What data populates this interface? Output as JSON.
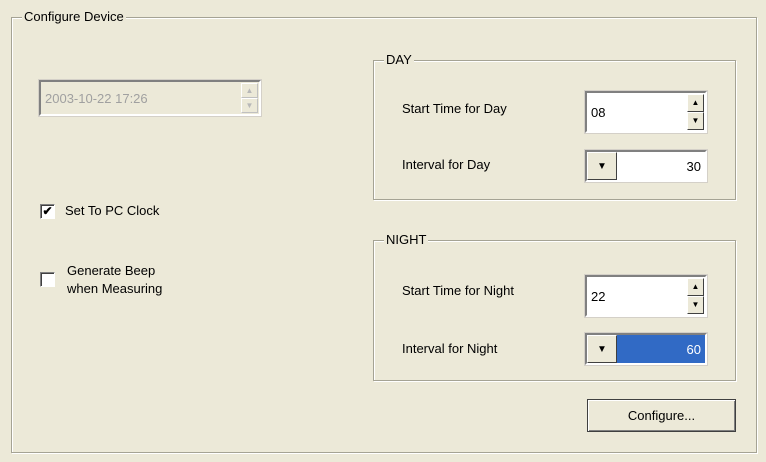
{
  "configure_group": {
    "title": "Configure Device"
  },
  "datetime": {
    "value": "2003-10-22 17:26",
    "up_icon": "▲",
    "down_icon": "▼"
  },
  "set_pc_clock": {
    "label": "Set To PC Clock",
    "checked_mark": "✔"
  },
  "beep": {
    "label_line1": "Generate Beep",
    "label_line2": "when Measuring",
    "checked_mark": ""
  },
  "day": {
    "title": "DAY",
    "start_label": "Start Time for Day",
    "start_value": "08",
    "interval_label": "Interval for Day",
    "interval_value": "30",
    "dropdown_icon": "▼"
  },
  "night": {
    "title": "NIGHT",
    "start_label": "Start Time for Night",
    "start_value": "22",
    "interval_label": "Interval for Night",
    "interval_value": "60",
    "dropdown_icon": "▼"
  },
  "spin_icons": {
    "up": "▲",
    "down": "▼"
  },
  "configure_button": {
    "label": "Configure..."
  },
  "colors": {
    "background": "#ece9d8",
    "selection": "#316ac5"
  }
}
